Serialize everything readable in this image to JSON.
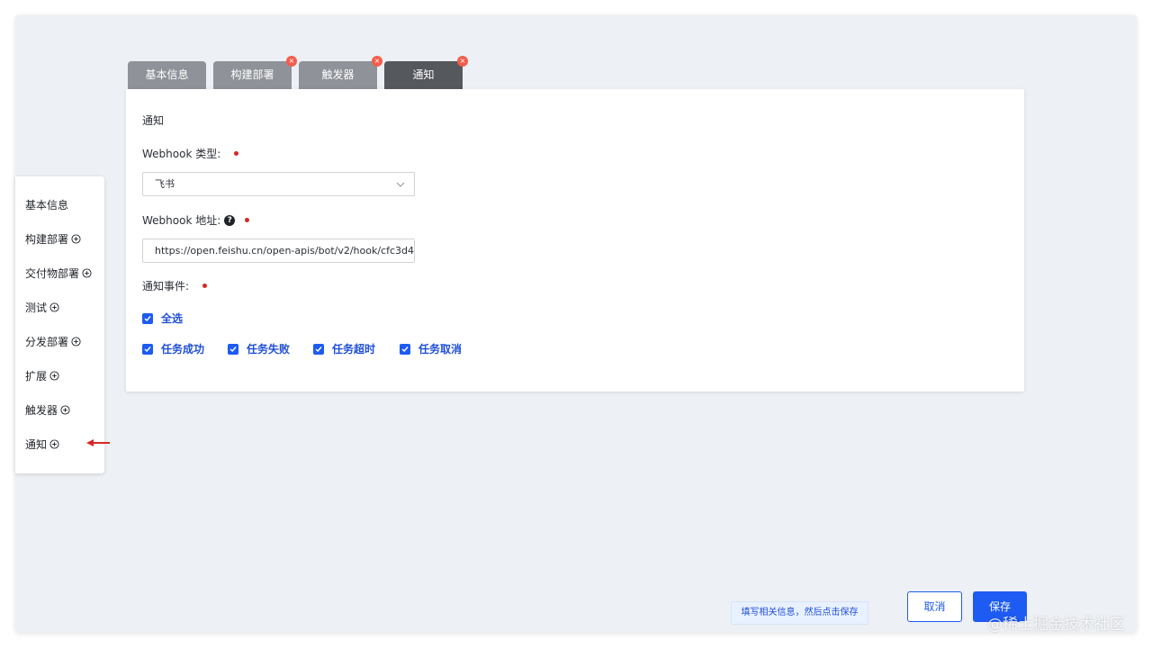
{
  "tabs": [
    {
      "label": "基本信息",
      "closable": false,
      "active": false
    },
    {
      "label": "构建部署",
      "closable": true,
      "active": false
    },
    {
      "label": "触发器",
      "closable": true,
      "active": false
    },
    {
      "label": "通知",
      "closable": true,
      "active": true
    }
  ],
  "icons": {
    "close": "×",
    "help": "?"
  },
  "card": {
    "title": "通知",
    "webhook_type_label": "Webhook 类型:",
    "webhook_type_value": "飞书",
    "webhook_url_label": "Webhook 地址:",
    "webhook_url_value": "https://open.feishu.cn/open-apis/bot/v2/hook/cfc3d4",
    "events_label": "通知事件:",
    "select_all": "全选",
    "events": [
      "任务成功",
      "任务失败",
      "任务超时",
      "任务取消"
    ]
  },
  "sidebar": {
    "items": [
      {
        "label": "基本信息",
        "addable": false
      },
      {
        "label": "构建部署",
        "addable": true
      },
      {
        "label": "交付物部署",
        "addable": true
      },
      {
        "label": "测试",
        "addable": true
      },
      {
        "label": "分发部署",
        "addable": true
      },
      {
        "label": "扩展",
        "addable": true
      },
      {
        "label": "触发器",
        "addable": true
      },
      {
        "label": "通知",
        "addable": true
      }
    ]
  },
  "footer": {
    "hint": "填写相关信息，然后点击保存",
    "cancel_label": "取消",
    "save_label": "保存"
  },
  "watermark": "@稀土掘金技术社区",
  "colors": {
    "primary": "#1d5bf2",
    "required": "#d92626",
    "tab_inactive": "#8f9399",
    "tab_active": "#55585d",
    "close_badge": "#f25d4a"
  }
}
